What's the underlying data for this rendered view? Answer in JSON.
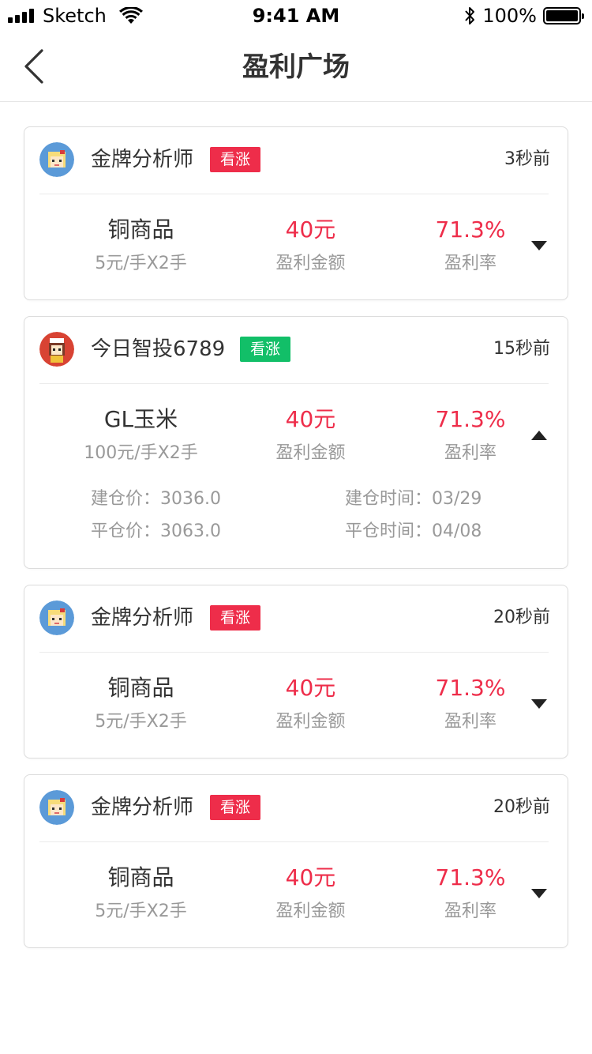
{
  "status_bar": {
    "carrier": "Sketch",
    "time": "9:41 AM",
    "battery": "100%"
  },
  "nav": {
    "title": "盈利广场"
  },
  "cards": [
    {
      "username": "金牌分析师",
      "tag": "看涨",
      "time": "3秒前",
      "product": "铜商品",
      "spec": "5元/手X2手",
      "profit": "40元",
      "profit_label": "盈利金额",
      "rate": "71.3%",
      "rate_label": "盈利率",
      "expanded": false
    },
    {
      "username": "今日智投6789",
      "tag": "看涨",
      "time": "15秒前",
      "product": "GL玉米",
      "spec": "100元/手X2手",
      "profit": "40元",
      "profit_label": "盈利金额",
      "rate": "71.3%",
      "rate_label": "盈利率",
      "expanded": true,
      "open_price": "建仓价：3036.0",
      "close_price": "平仓价：3063.0",
      "open_time": "建仓时间：03/29",
      "close_time": "平仓时间：04/08"
    },
    {
      "username": "金牌分析师",
      "tag": "看涨",
      "time": "20秒前",
      "product": "铜商品",
      "spec": "5元/手X2手",
      "profit": "40元",
      "profit_label": "盈利金额",
      "rate": "71.3%",
      "rate_label": "盈利率",
      "expanded": false
    },
    {
      "username": "金牌分析师",
      "tag": "看涨",
      "time": "20秒前",
      "product": "铜商品",
      "spec": "5元/手X2手",
      "profit": "40元",
      "profit_label": "盈利金额",
      "rate": "71.3%",
      "rate_label": "盈利率",
      "expanded": false
    }
  ],
  "colors": {
    "accent_red": "#ee2d4a",
    "tag_green": "#12bf68"
  },
  "icons": {
    "back": "chevron-left-icon",
    "expand": "caret-down-icon",
    "collapse": "caret-up-icon"
  }
}
